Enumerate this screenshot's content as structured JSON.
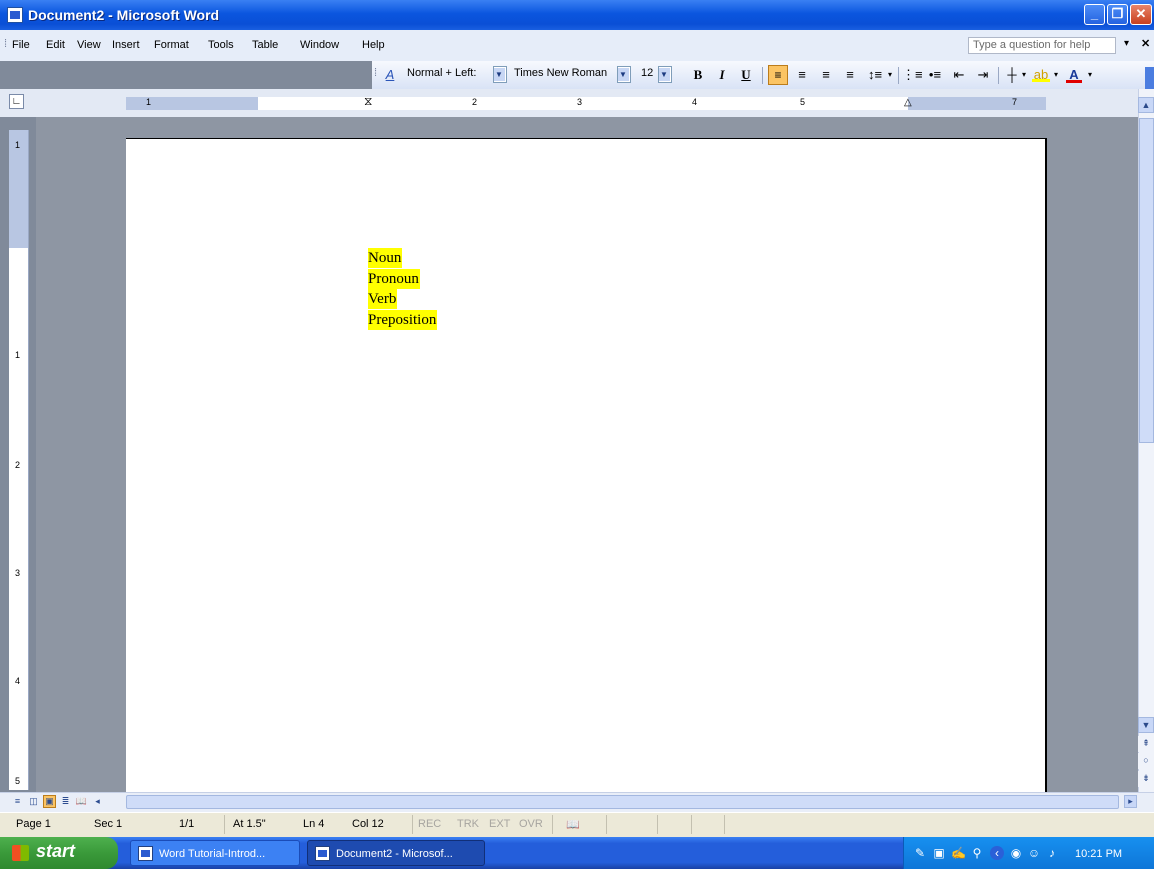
{
  "window": {
    "title": "Document2 - Microsoft Word"
  },
  "menu": [
    "File",
    "Edit",
    "View",
    "Insert",
    "Format",
    "Tools",
    "Table",
    "Window",
    "Help"
  ],
  "help_box": {
    "placeholder": "Type a question for help"
  },
  "toolbar": {
    "style": "Normal + Left:",
    "font": "Times New Roman",
    "size": "12",
    "bold": "B",
    "italic": "I",
    "underline": "U"
  },
  "document": {
    "lines": [
      "Noun",
      "Pronoun",
      "Verb",
      "Preposition"
    ],
    "highlight_color": "#ffff00"
  },
  "ruler": {
    "numbers": [
      "1",
      "1",
      "2",
      "3",
      "4",
      "5",
      "7"
    ],
    "vnumbers": [
      "1",
      "1",
      "2",
      "3",
      "4",
      "5"
    ]
  },
  "status": {
    "page": "Page 1",
    "sec": "Sec 1",
    "pages": "1/1",
    "at": "At 1.5\"",
    "ln": "Ln 4",
    "col": "Col 12",
    "rec": "REC",
    "trk": "TRK",
    "ext": "EXT",
    "ovr": "OVR"
  },
  "taskbar": {
    "start": "start",
    "tasks": [
      "Word Tutorial-Introd...",
      "Document2 - Microsof..."
    ],
    "clock": "10:21 PM"
  },
  "colors": {
    "titlebar": "#0b56df",
    "taskbar": "#245edb",
    "start": "#3a9a3a",
    "highlight": "#ffff00"
  }
}
